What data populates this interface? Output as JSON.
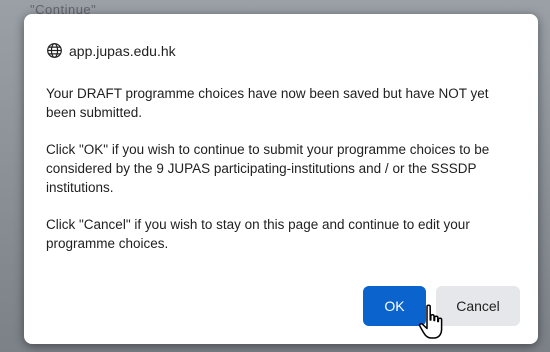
{
  "background": {
    "text": "\"Continue\""
  },
  "dialog": {
    "origin": "app.jupas.edu.hk",
    "origin_icon": "globe-icon",
    "paragraphs": [
      "Your DRAFT programme choices have now been saved but have NOT yet been submitted.",
      "Click \"OK\" if you wish to continue to submit your programme choices to be considered by the 9 JUPAS participating-institutions and / or the SSSDP institutions.",
      "Click \"Cancel\" if you wish to stay on this page and continue to edit your programme choices."
    ],
    "ok_label": "OK",
    "cancel_label": "Cancel"
  },
  "cursor": {
    "icon": "hand-pointer-icon"
  },
  "colors": {
    "ok_button": "#0b63ce",
    "cancel_button": "#e6e7ea",
    "dialog_bg": "#ffffff"
  }
}
